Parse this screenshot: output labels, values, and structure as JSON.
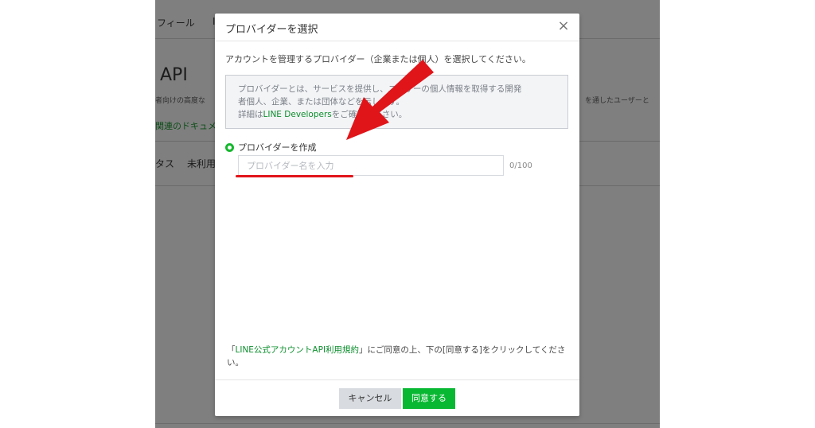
{
  "background": {
    "tab_profile": "フィール",
    "tab_partial": "I",
    "api_heading": "API",
    "description_fragment": "者向けの高度な",
    "description_right": "を通したユーザーと",
    "docs_link": "関連のドキュメ",
    "status_label": "タス",
    "unused_label": "未利用"
  },
  "modal": {
    "title": "プロバイダーを選択",
    "close_glyph": "×",
    "description": "アカウントを管理するプロバイダー（企業または個人）を選択してください。",
    "info": {
      "line1": "プロバイダーとは、サービスを提供し、ユーザーの個人情報を取得する開発",
      "line2": "者個人、企業、または団体などを示します。",
      "line3_prefix": "詳細は",
      "line3_link": "LINE Developers",
      "line3_suffix": "をご確認ください。"
    },
    "radio_label": "プロバイダーを作成",
    "input_placeholder": "プロバイダー名を入力",
    "input_value": "",
    "counter": "0/100",
    "terms": {
      "open_bracket": "「",
      "link": "LINE公式アカウントAPI利用規約",
      "rest": "」にご同意の上、下の[同意する]をクリックしてください。"
    },
    "cancel_label": "キャンセル",
    "agree_label": "同意する"
  },
  "colors": {
    "accent_green": "#08b832",
    "annotation_red": "#e0151a"
  }
}
